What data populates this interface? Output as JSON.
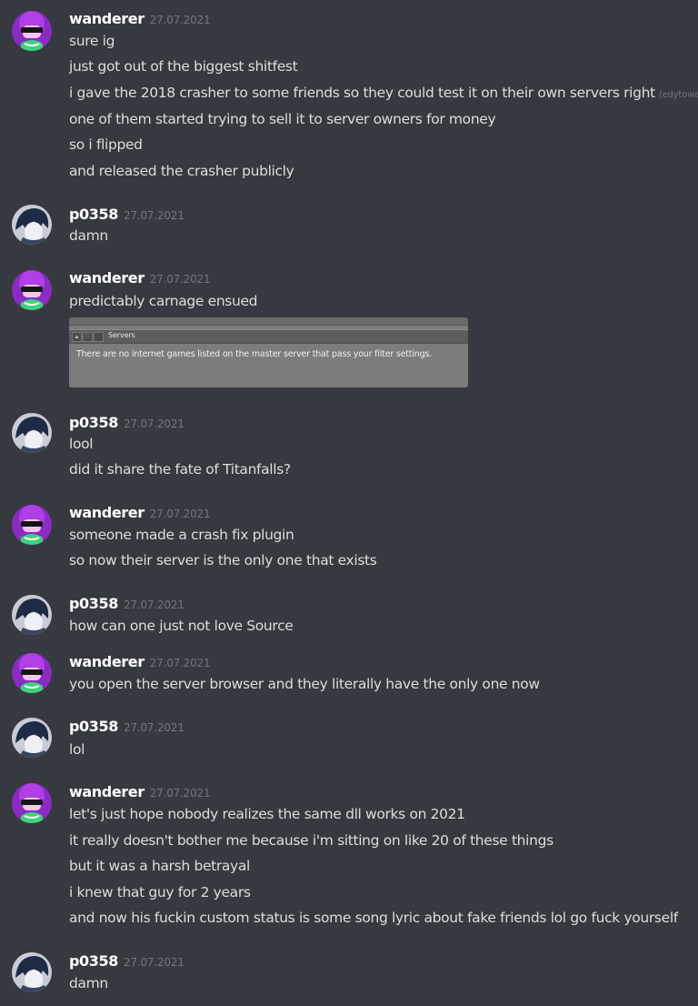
{
  "users": {
    "wanderer": {
      "name": "wanderer",
      "avatar": "purple-haired-sunglasses-avatar"
    },
    "p0358": {
      "name": "p0358",
      "avatar": "dark-haired-anime-avatar"
    }
  },
  "groups": [
    {
      "author": "wanderer",
      "timestamp": "27.07.2021",
      "messages": [
        {
          "text": "sure ig"
        },
        {
          "text": "just got out of the biggest shitfest"
        },
        {
          "text": "i gave the 2018 crasher to some friends so they could test it on their own servers right",
          "edited": "(edytowane)"
        },
        {
          "text": "one of them started trying to sell it to server owners for money"
        },
        {
          "text": "so i flipped"
        },
        {
          "text": "and released the crasher publicly"
        }
      ]
    },
    {
      "author": "p0358",
      "timestamp": "27.07.2021",
      "messages": [
        {
          "text": "damn"
        }
      ]
    },
    {
      "author": "wanderer",
      "timestamp": "27.07.2021",
      "messages": [
        {
          "text": "predictably carnage ensued"
        }
      ],
      "attachment": {
        "window_title": "Servers",
        "body_text": "There are no internet games listed on the master server that pass your filter settings."
      }
    },
    {
      "author": "p0358",
      "timestamp": "27.07.2021",
      "messages": [
        {
          "text": "lool"
        },
        {
          "text": "did it share the fate of Titanfalls?"
        }
      ]
    },
    {
      "author": "wanderer",
      "timestamp": "27.07.2021",
      "messages": [
        {
          "text": "someone made a crash fix plugin"
        },
        {
          "text": "so now their server is the only one that exists"
        }
      ]
    },
    {
      "author": "p0358",
      "timestamp": "27.07.2021",
      "messages": [
        {
          "text": "how can one just not love Source"
        }
      ]
    },
    {
      "author": "wanderer",
      "timestamp": "27.07.2021",
      "messages": [
        {
          "text": "you open the server browser and they literally have the only one now"
        }
      ]
    },
    {
      "author": "p0358",
      "timestamp": "27.07.2021",
      "messages": [
        {
          "text": "lol"
        }
      ]
    },
    {
      "author": "wanderer",
      "timestamp": "27.07.2021",
      "messages": [
        {
          "text": "let's just hope nobody realizes the same dll works on 2021"
        },
        {
          "text": "it really doesn't bother me because i'm sitting on like 20 of these things"
        },
        {
          "text": "but it was a harsh betrayal"
        },
        {
          "text": "i knew that guy for 2 years"
        },
        {
          "text": "and now his fuckin custom status is some song lyric about fake friends lol go fuck yourself"
        }
      ]
    },
    {
      "author": "p0358",
      "timestamp": "27.07.2021",
      "messages": [
        {
          "text": "damn"
        }
      ]
    }
  ],
  "colors": {
    "background": "#36393f",
    "username": "#ffffff",
    "timestamp": "#72767d",
    "message_text": "#dcddde",
    "wanderer_avatar": "#9b2fd1",
    "p0358_avatar": "#2d3a52"
  }
}
